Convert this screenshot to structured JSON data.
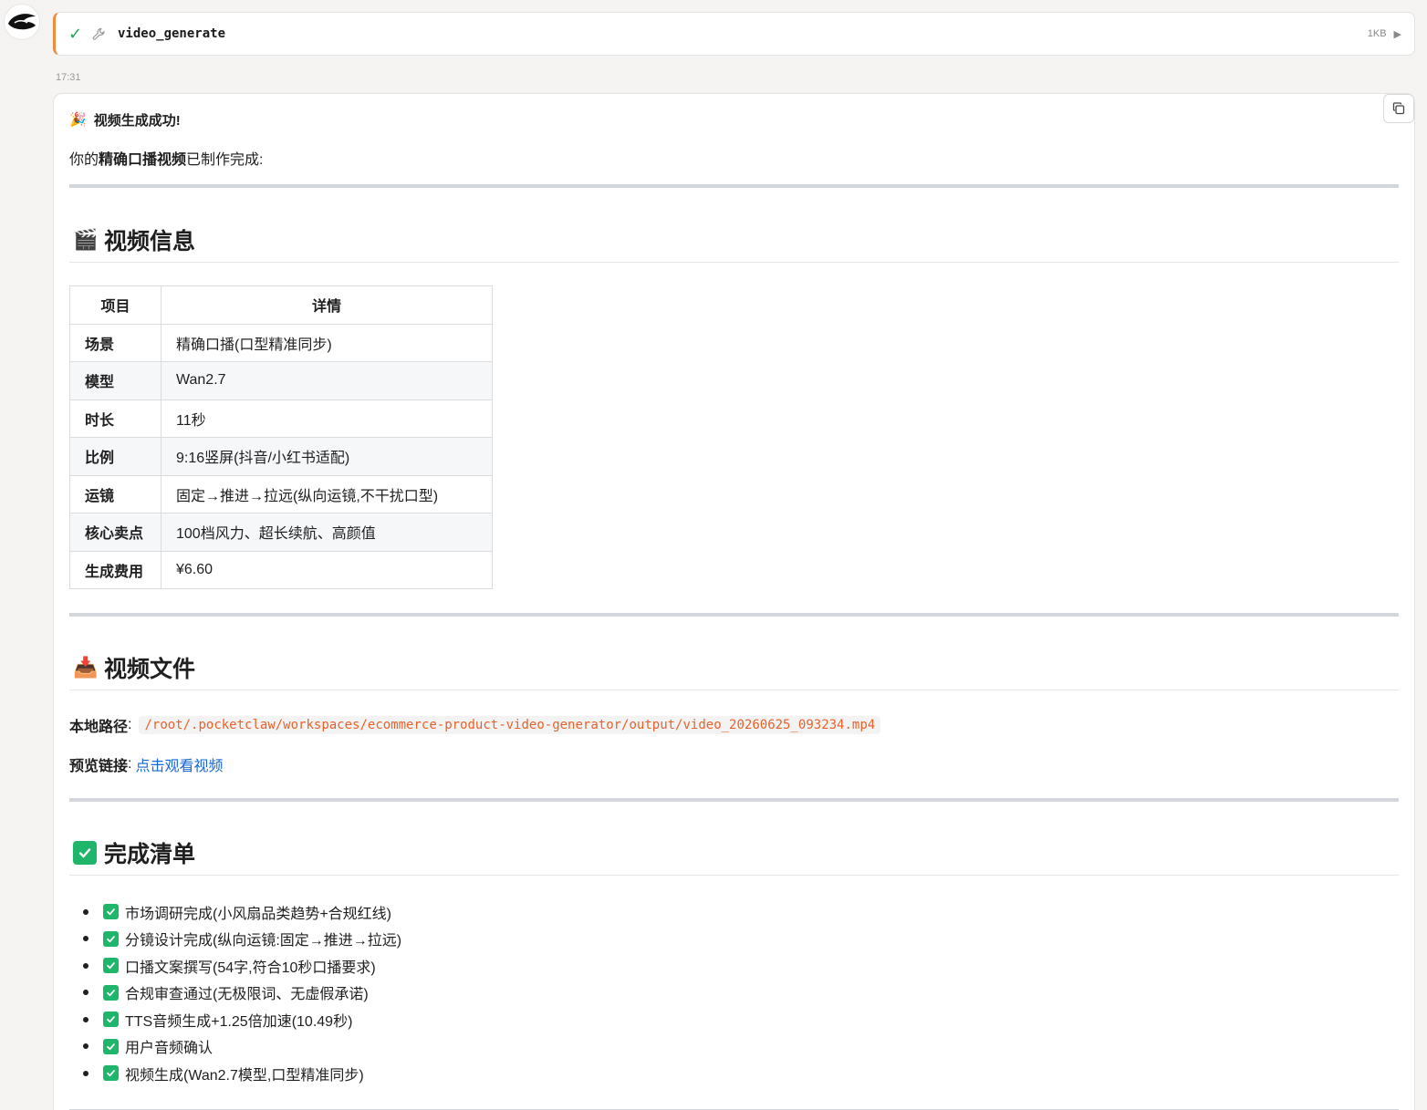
{
  "tool_call": {
    "status_icon": "check-icon",
    "tool_icon": "wrench-icon",
    "name": "video_generate",
    "size": "1KB",
    "expand_icon": "play-arrow-icon"
  },
  "timestamp": "17:31",
  "message": {
    "success_emoji": "🎉",
    "success_title": "视频生成成功!",
    "intro_prefix": "你的",
    "intro_bold": "精确口播视频",
    "intro_suffix": "已制作完成:",
    "sections": {
      "info": {
        "emoji": "🎬",
        "title": "视频信息",
        "headers": [
          "项目",
          "详情"
        ],
        "rows": [
          {
            "label": "场景",
            "value": "精确口播(口型精准同步)"
          },
          {
            "label": "模型",
            "value": "Wan2.7"
          },
          {
            "label": "时长",
            "value": "11秒"
          },
          {
            "label": "比例",
            "value": "9:16竖屏(抖音/小红书适配)"
          },
          {
            "label": "运镜",
            "value": "固定→推进→拉远(纵向运镜,不干扰口型)"
          },
          {
            "label": "核心卖点",
            "value": "100档风力、超长续航、高颜值"
          },
          {
            "label": "生成费用",
            "value": "¥6.60"
          }
        ]
      },
      "file": {
        "emoji": "📥",
        "title": "视频文件",
        "path_label": "本地路径",
        "path_sep": ":",
        "path_value": "/root/.pocketclaw/workspaces/ecommerce-product-video-generator/output/video_20260625_093234.mp4",
        "preview_label": "预览链接",
        "preview_sep": ":",
        "preview_link": "点击观看视频"
      },
      "checklist": {
        "emoji": "✅",
        "title": "完成清单",
        "items": [
          "市场调研完成(小风扇品类趋势+合规红线)",
          "分镜设计完成(纵向运镜:固定→推进→拉远)",
          "口播文案撰写(54字,符合10秒口播要求)",
          "合规审查通过(无极限词、无虚假承诺)",
          "TTS音频生成+1.25倍加速(10.49秒)",
          "用户音频确认",
          "视频生成(Wan2.7模型,口型精准同步)"
        ]
      }
    },
    "copy_icon": "copy-icon"
  },
  "colors": {
    "accent_orange": "#f08a3c",
    "check_green": "#1fb56a",
    "link_blue": "#1668d8",
    "code_orange": "#e8622a"
  }
}
